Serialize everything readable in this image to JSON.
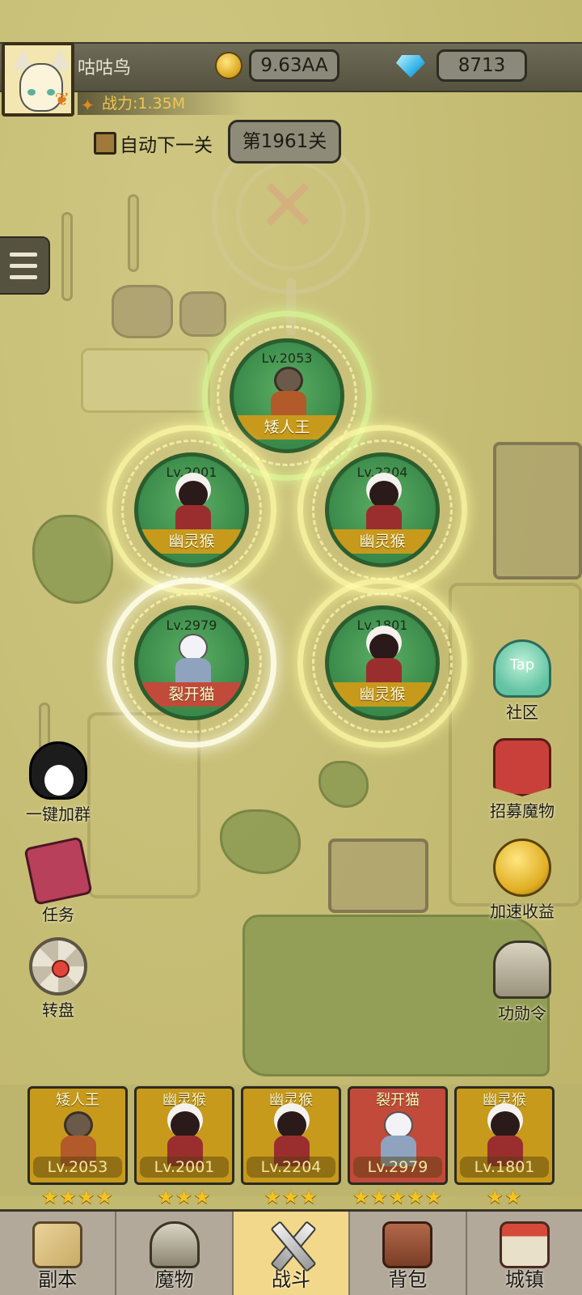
{
  "player": {
    "name": "咕咕鸟",
    "power": "战力:1.35M",
    "gold": "9.63AA",
    "gems": "8713"
  },
  "stage": {
    "auto_next_label": "自动下一关",
    "current": "第1961关"
  },
  "formation": [
    {
      "name": "矮人王",
      "level": "Lv.2053",
      "type": "dwarf",
      "tag_color": "#c79a1c"
    },
    {
      "name": "幽灵猴",
      "level": "Lv.2001",
      "type": "monkey",
      "tag_color": "#c79a1c"
    },
    {
      "name": "幽灵猴",
      "level": "Lv.2204",
      "type": "monkey",
      "tag_color": "#c79a1c"
    },
    {
      "name": "裂开猫",
      "level": "Lv.2979",
      "type": "cat",
      "tag_color": "#c24a3a"
    },
    {
      "name": "幽灵猴",
      "level": "Lv.1801",
      "type": "monkey",
      "tag_color": "#c79a1c"
    }
  ],
  "side_left": [
    {
      "label": "一键加群",
      "icon": "penguin-icon"
    },
    {
      "label": "任务",
      "icon": "book-icon"
    },
    {
      "label": "转盘",
      "icon": "wheel-icon"
    }
  ],
  "side_right": [
    {
      "label": "社区",
      "icon": "tap-icon",
      "icon_text": "Tap"
    },
    {
      "label": "招募魔物",
      "icon": "banner-icon"
    },
    {
      "label": "加速收益",
      "icon": "coin-boost-icon"
    },
    {
      "label": "功勋令",
      "icon": "helmet-icon"
    }
  ],
  "team": [
    {
      "name": "矮人王",
      "level": "Lv.2053",
      "stars": "★★★★",
      "star_count": 4
    },
    {
      "name": "幽灵猴",
      "level": "Lv.2001",
      "stars": "★★★",
      "star_count": 3
    },
    {
      "name": "幽灵猴",
      "level": "Lv.2204",
      "stars": "★★★",
      "star_count": 3
    },
    {
      "name": "裂开猫",
      "level": "Lv.2979",
      "stars": "★★★★★",
      "star_count": 5
    },
    {
      "name": "幽灵猴",
      "level": "Lv.1801",
      "stars": "★★",
      "star_count": 2
    }
  ],
  "nav": [
    {
      "label": "副本",
      "icon": "map-icon"
    },
    {
      "label": "魔物",
      "icon": "helmet-icon"
    },
    {
      "label": "战斗",
      "icon": "swords-icon",
      "active": true
    },
    {
      "label": "背包",
      "icon": "backpack-icon"
    },
    {
      "label": "城镇",
      "icon": "shop-icon"
    }
  ],
  "colors": {
    "map_bg": "#c9c178",
    "topbar": "#6e6b58",
    "gold_tag": "#c79a1c",
    "red_tag": "#c24a3a",
    "active_nav": "#f2d88a"
  }
}
